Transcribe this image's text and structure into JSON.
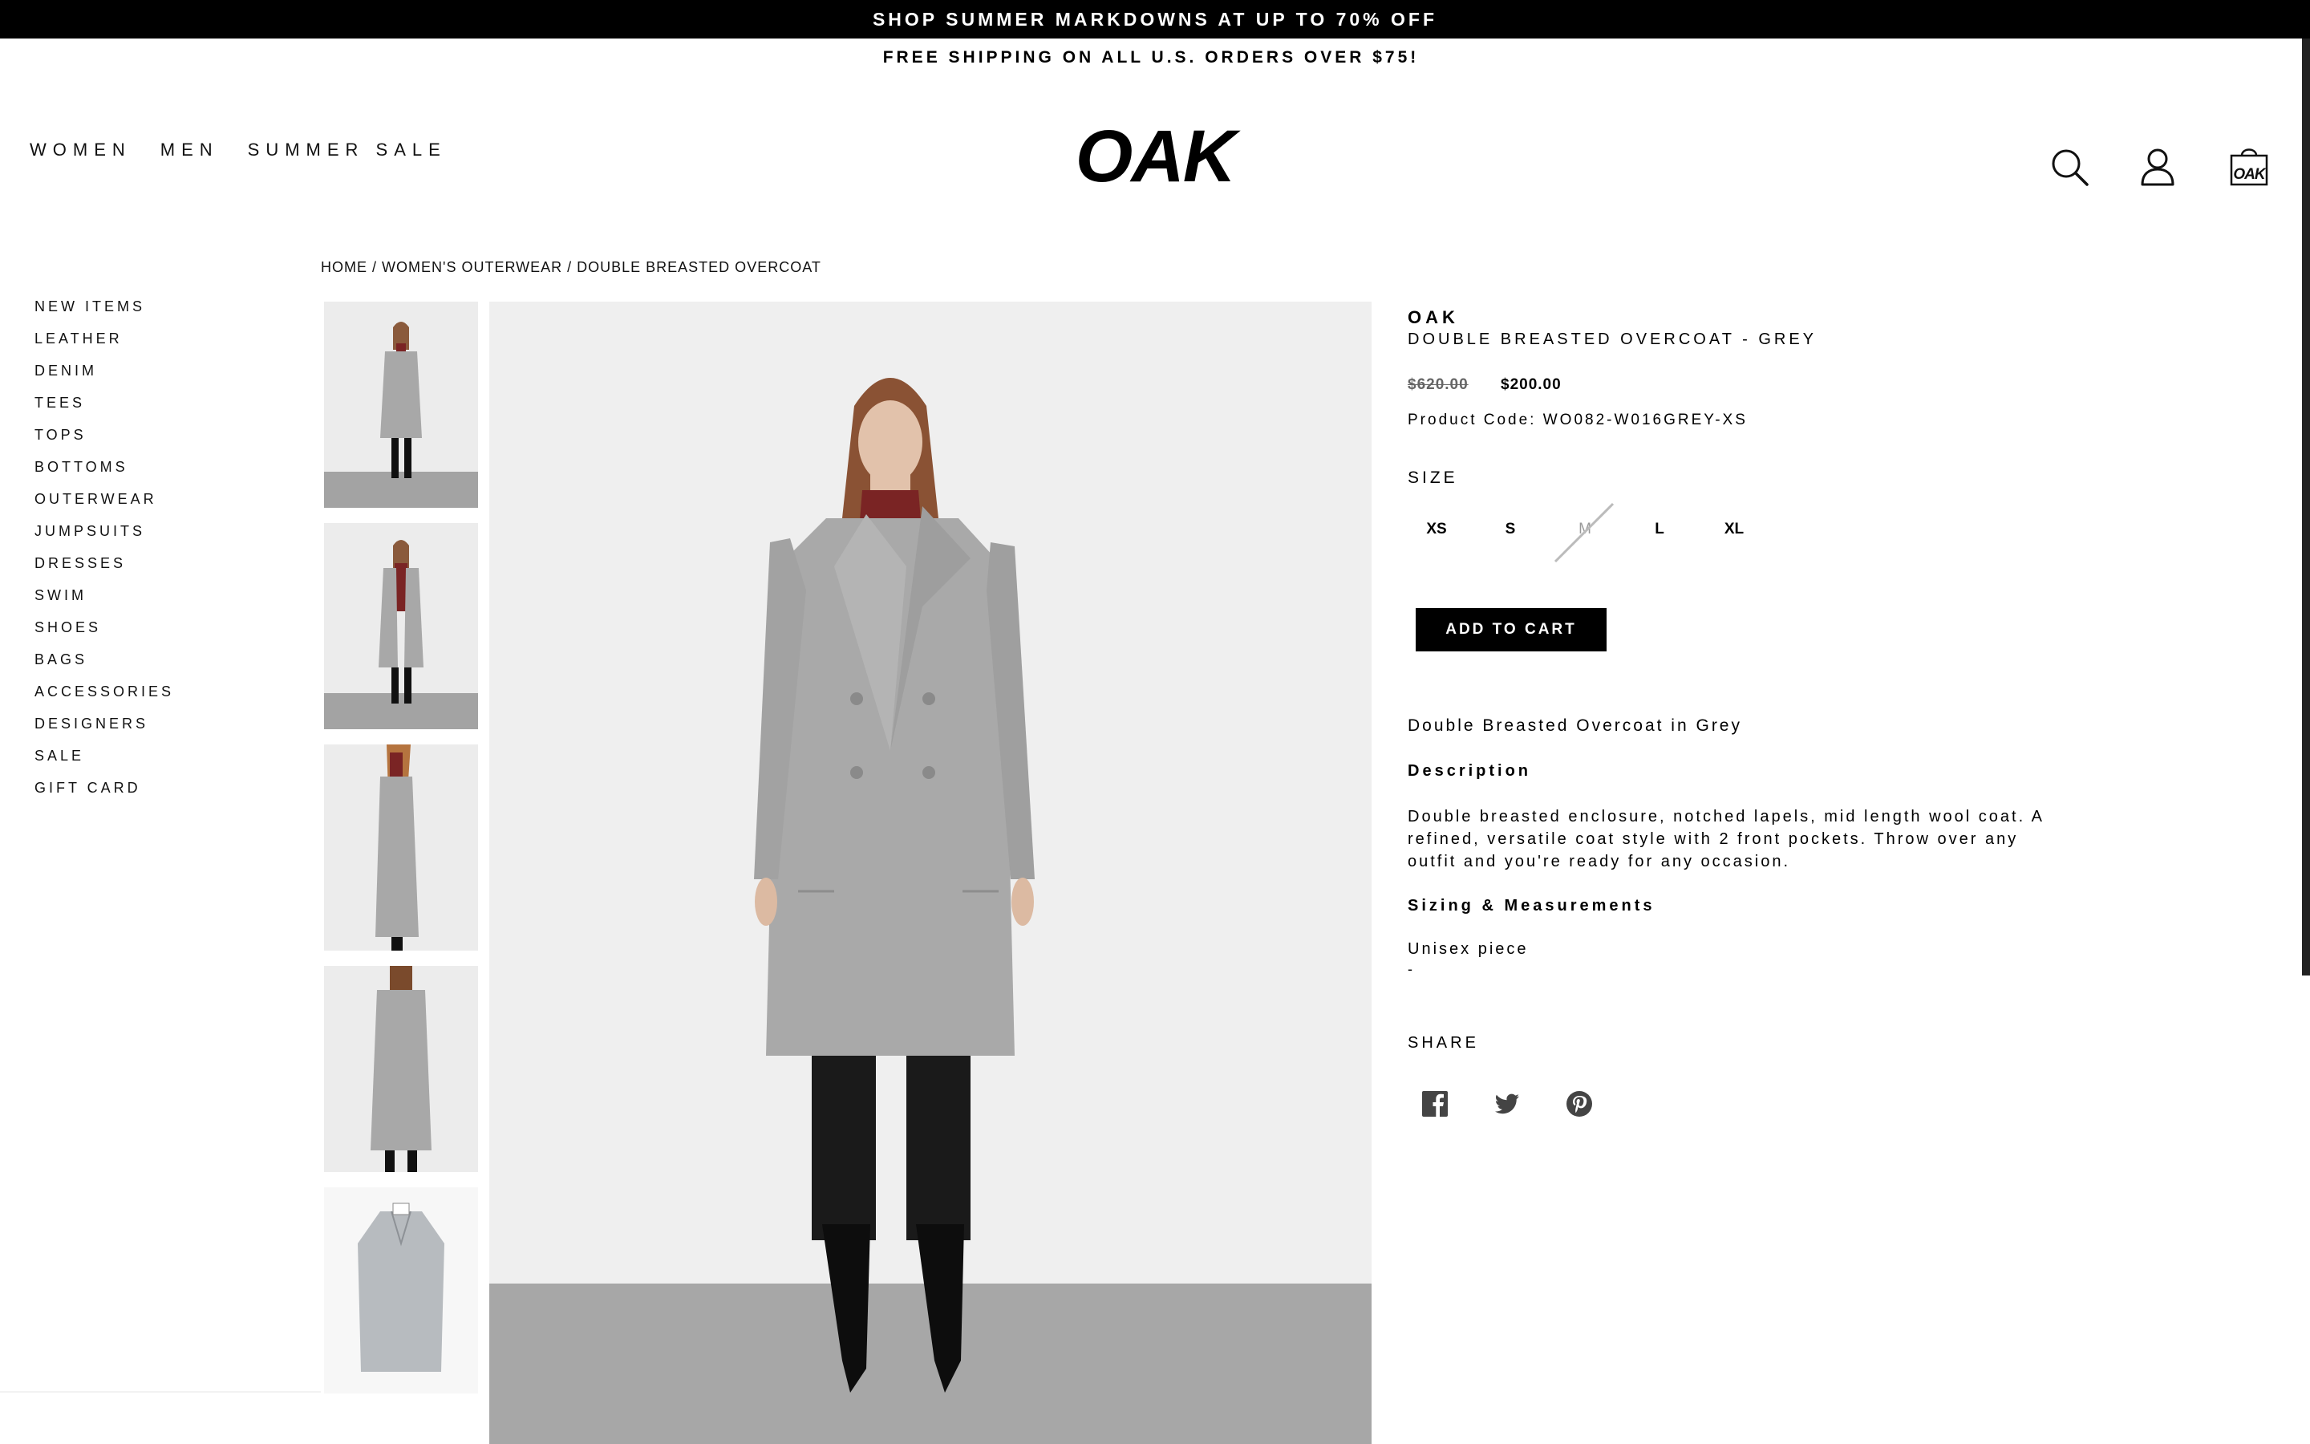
{
  "promo": {
    "text": "SHOP SUMMER MARKDOWNS AT UP TO 70% OFF"
  },
  "shipping": {
    "text": "FREE SHIPPING ON ALL U.S. ORDERS OVER $75!"
  },
  "nav": {
    "items": [
      "WOMEN",
      "MEN",
      "SUMMER SALE"
    ]
  },
  "logo": {
    "text": "OAK"
  },
  "icons": {
    "search": "search-icon",
    "account": "user-icon",
    "cart": "shopping-bag-icon",
    "cart_text": "OAK"
  },
  "breadcrumb": {
    "items": [
      "HOME",
      "WOMEN'S OUTERWEAR",
      "DOUBLE BREASTED OVERCOAT"
    ],
    "separator": "/"
  },
  "sidebar": {
    "items": [
      "NEW ITEMS",
      "LEATHER",
      "DENIM",
      "TEES",
      "TOPS",
      "BOTTOMS",
      "OUTERWEAR",
      "JUMPSUITS",
      "DRESSES",
      "SWIM",
      "SHOES",
      "BAGS",
      "ACCESSORIES",
      "DESIGNERS",
      "SALE",
      "GIFT CARD"
    ]
  },
  "product": {
    "brand": "OAK",
    "name": "DOUBLE BREASTED OVERCOAT - GREY",
    "old_price": "$620.00",
    "price": "$200.00",
    "code": "Product Code: WO082-W016GREY-XS",
    "size_label": "SIZE",
    "sizes": [
      "XS",
      "S",
      "M",
      "L",
      "XL"
    ],
    "unavailable_size": "M",
    "add_to_cart": "ADD TO CART",
    "lead": "Double Breasted Overcoat in Grey",
    "description_title": "Description",
    "description": "Double breasted enclosure, notched lapels, mid length wool coat. A refined, versatile coat style with 2 front pockets. Throw over any outfit and you're ready for any occasion.",
    "sizing_title": "Sizing & Measurements",
    "sizing_text": "Unisex piece",
    "sizing_extra": "-",
    "share_label": "SHARE",
    "share_icons": [
      "facebook-icon",
      "twitter-icon",
      "pinterest-icon"
    ]
  },
  "colors": {
    "coat": "#a8a8a8",
    "turtleneck": "#7a2424",
    "black": "#000000",
    "floor": "#a3a3a3",
    "backdrop": "#eeeeee"
  }
}
